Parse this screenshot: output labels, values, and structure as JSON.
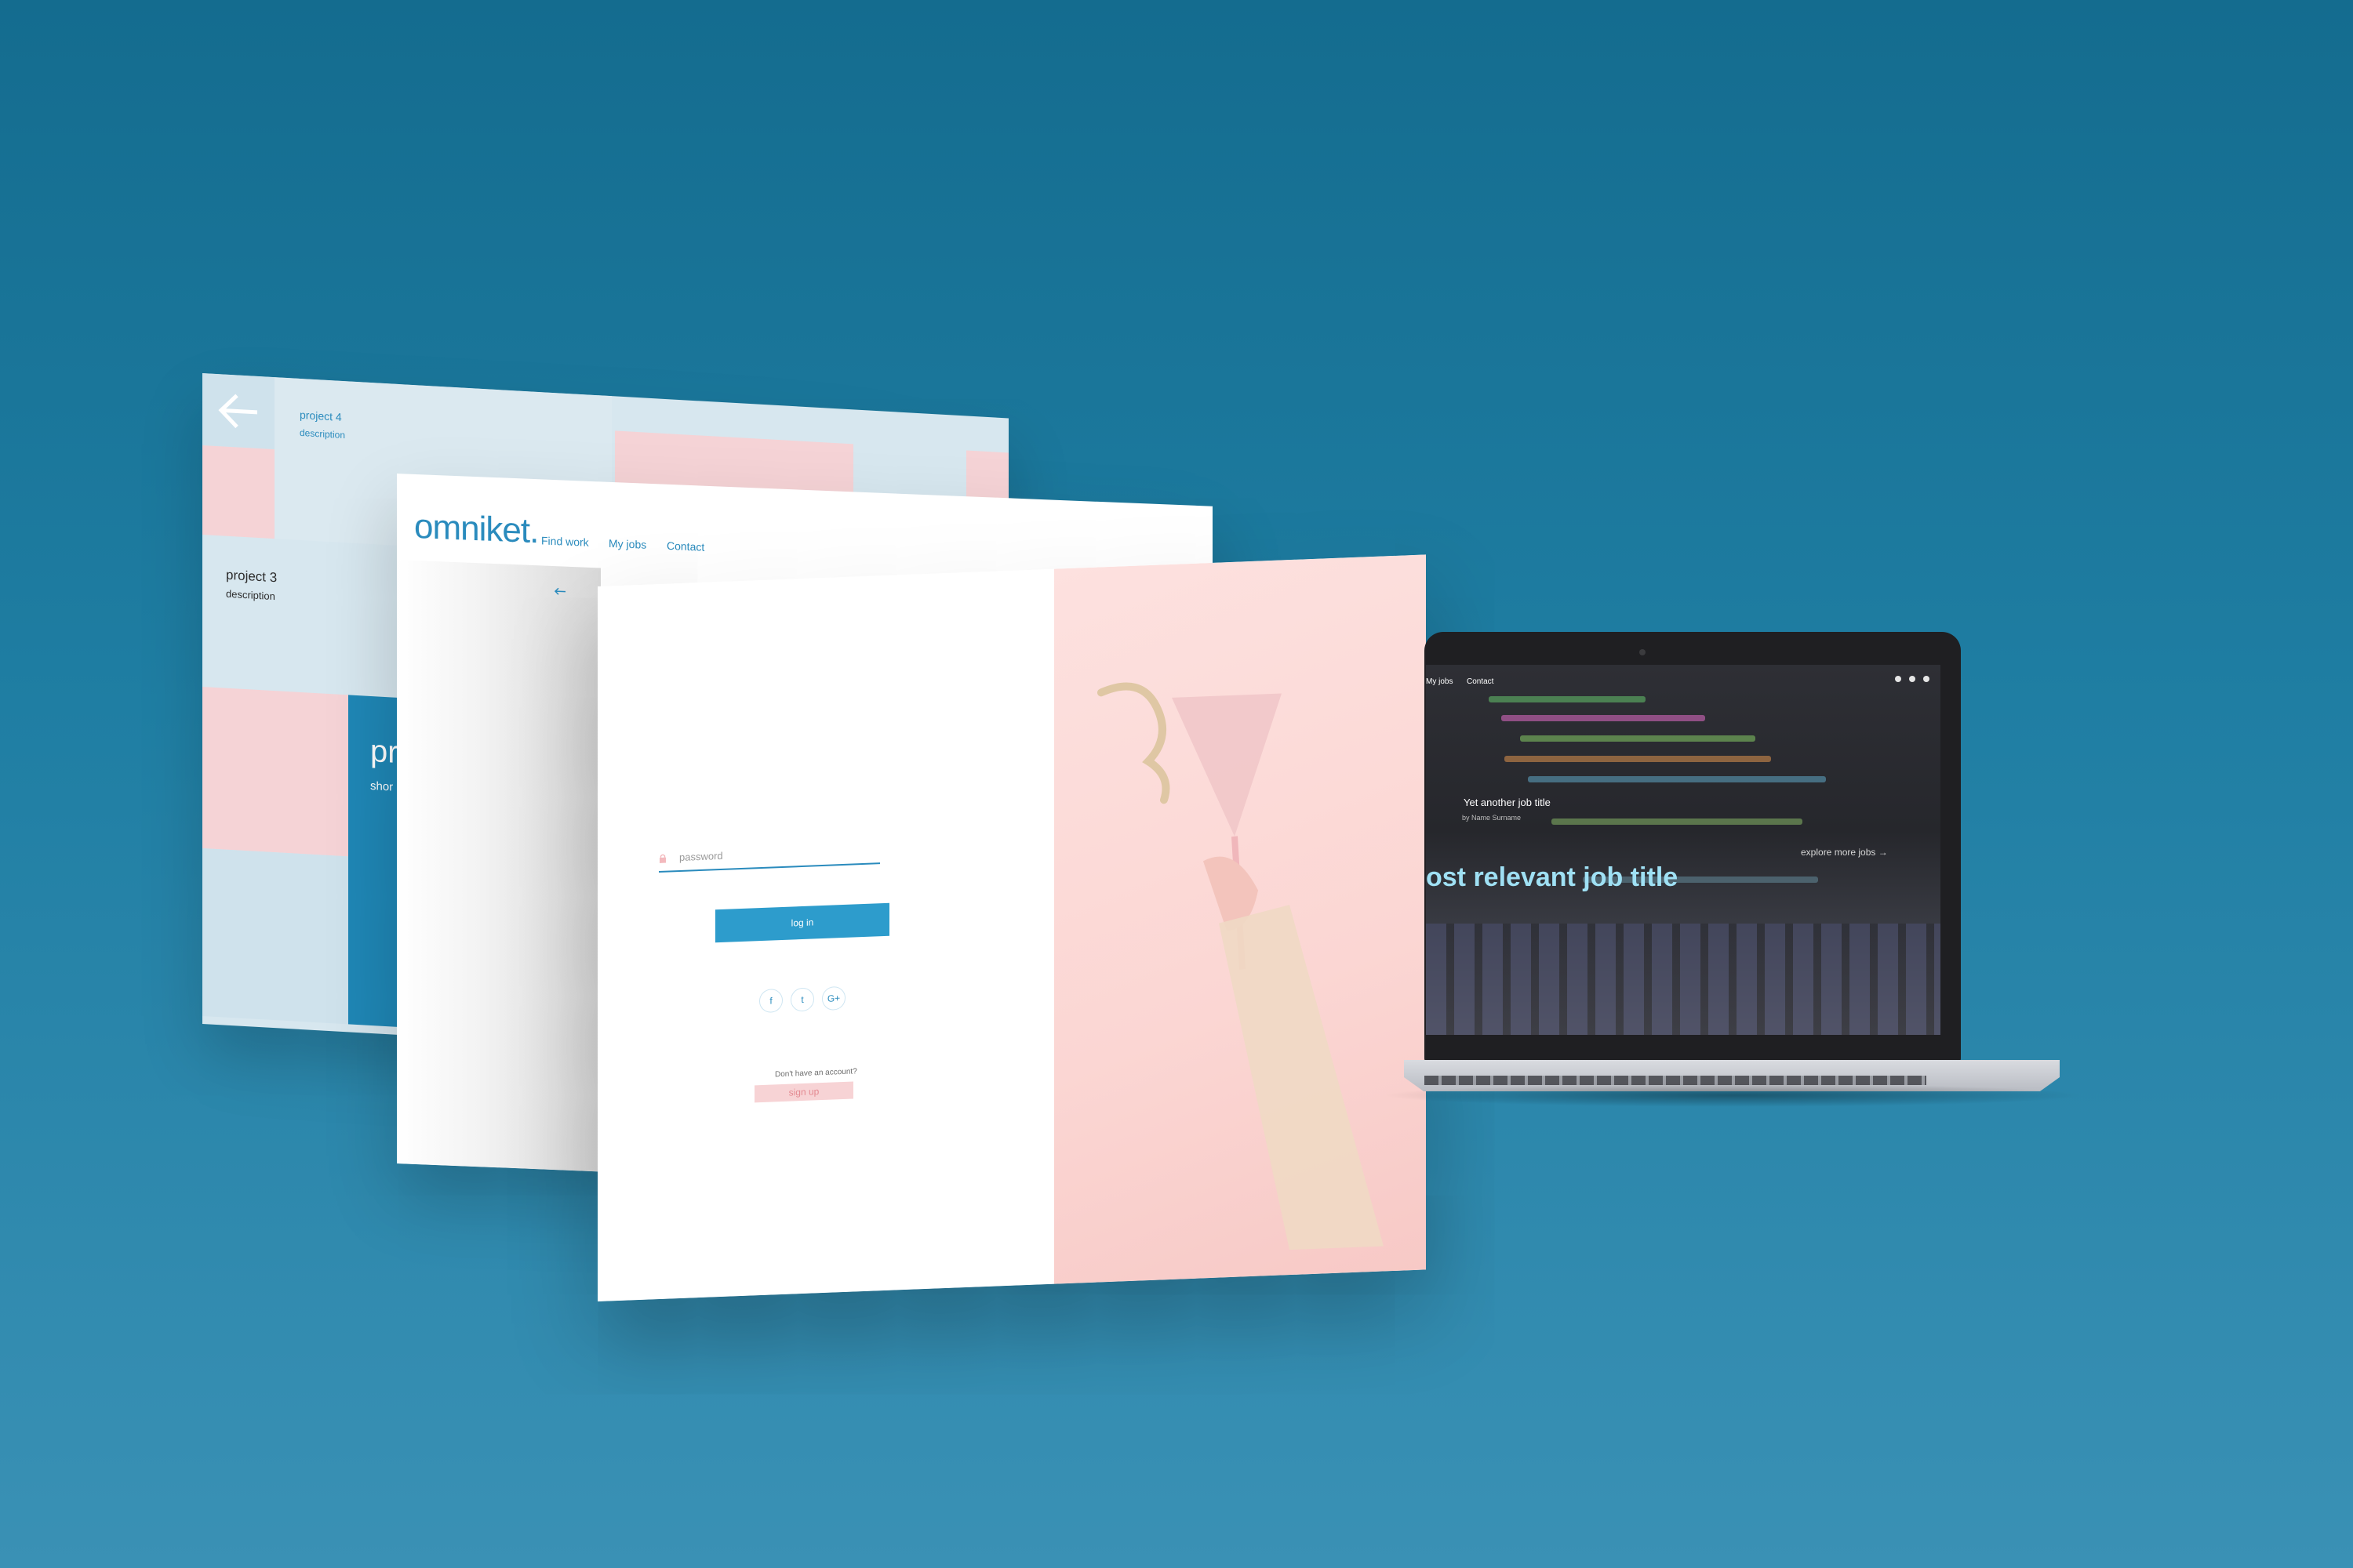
{
  "back_screen": {
    "project4": {
      "title": "project 4",
      "description": "description"
    },
    "project3": {
      "title": "project 3",
      "description": "description"
    },
    "featured": {
      "title": "pr",
      "short": "shor"
    }
  },
  "header": {
    "logo": "omniket.",
    "nav": {
      "find_work": "Find work",
      "my_jobs": "My jobs",
      "contact": "Contact"
    }
  },
  "login": {
    "password_placeholder": "password",
    "login_button": "log in",
    "social": {
      "facebook": "f",
      "twitter": "t",
      "google": "G+"
    },
    "no_account": "Don't have an account?",
    "signup_button": "sign up"
  },
  "laptop_screen": {
    "nav": {
      "my_jobs": "My jobs",
      "contact": "Contact"
    },
    "job_title": "Yet another job title",
    "job_author": "by Name Surname",
    "explore": "explore more jobs",
    "main_title": "ost relevant job title"
  },
  "colors": {
    "brand_blue": "#2a8bbd",
    "pink": "#f5d3d6",
    "button_blue": "#2d9ccc",
    "background": "#1f7ea3",
    "laptop_title": "#9fe0f4"
  },
  "icons": [
    "back-arrow-icon",
    "search-icon",
    "bell-icon",
    "user-icon",
    "lock-icon",
    "arrow-right-icon"
  ]
}
